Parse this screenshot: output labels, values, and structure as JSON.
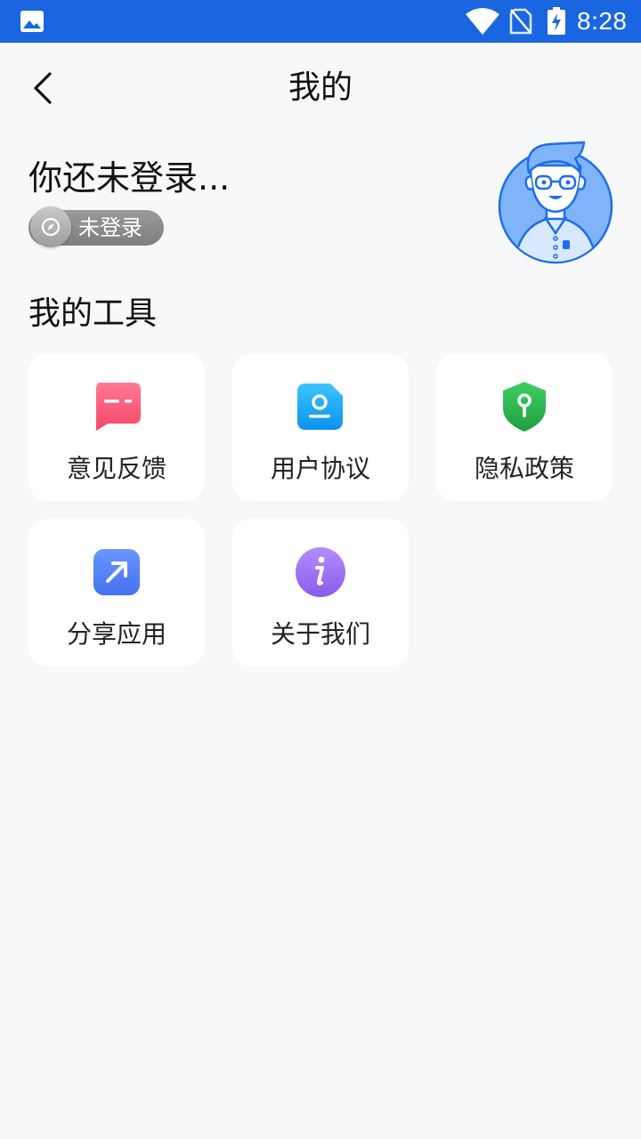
{
  "status_bar": {
    "time": "8:28",
    "icons": [
      "image-icon",
      "wifi-icon",
      "no-sim-icon",
      "battery-charging-icon"
    ],
    "color": "#1a66e0"
  },
  "header": {
    "title": "我的",
    "back_icon": "chevron-left-icon"
  },
  "user": {
    "login_prompt": "你还未登录...",
    "badge_label": "未登录",
    "avatar_icon": "user-avatar-illustration"
  },
  "tools": {
    "section_title": "我的工具",
    "items": [
      {
        "label": "意见反馈",
        "icon": "feedback-chat-icon",
        "color": "#ff5a78"
      },
      {
        "label": "用户协议",
        "icon": "user-agreement-icon",
        "color": "#1ea8f5"
      },
      {
        "label": "隐私政策",
        "icon": "privacy-shield-icon",
        "color": "#2bb24c"
      },
      {
        "label": "分享应用",
        "icon": "share-arrow-icon",
        "color": "#4c7bf3"
      },
      {
        "label": "关于我们",
        "icon": "info-icon",
        "color": "#9b6cf0"
      }
    ]
  }
}
